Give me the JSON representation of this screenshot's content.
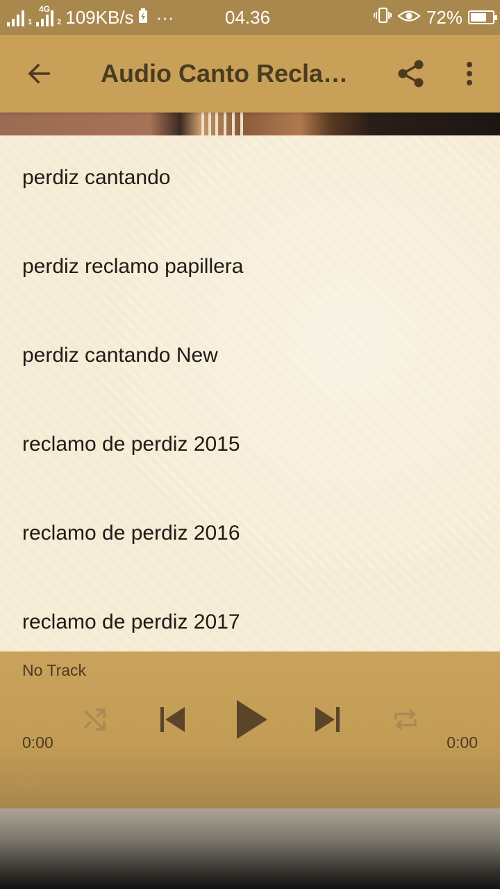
{
  "status_bar": {
    "sim1_label": "1",
    "sim2_label": "2",
    "network_type": "4G",
    "data_speed": "109KB/s",
    "more_indicator": "···",
    "time": "04.36",
    "battery_percent": "72%",
    "battery_level": 0.72,
    "icons": [
      "signal-icon",
      "battery-saver-icon",
      "vibrate-icon",
      "eye-icon",
      "battery-icon"
    ]
  },
  "app_bar": {
    "title": "Audio Canto Recla…",
    "background": "#c8a058",
    "text_color": "#4a3b22",
    "icons": [
      "back-arrow-icon",
      "share-icon",
      "more-vert-icon"
    ]
  },
  "list": {
    "items": [
      {
        "label": "perdiz cantando"
      },
      {
        "label": "perdiz reclamo papillera"
      },
      {
        "label": "perdiz cantando New"
      },
      {
        "label": "reclamo de perdiz 2015"
      },
      {
        "label": "reclamo de perdiz 2016"
      },
      {
        "label": "reclamo de perdiz 2017"
      }
    ]
  },
  "player": {
    "track_title": "No Track",
    "current_time": "0:00",
    "total_time": "0:00",
    "progress": 0,
    "controls": [
      "shuffle-icon",
      "skip-previous-icon",
      "play-icon",
      "skip-next-icon",
      "repeat-icon"
    ],
    "accent": "#c9a35c",
    "icon_color": "#5a4528"
  }
}
